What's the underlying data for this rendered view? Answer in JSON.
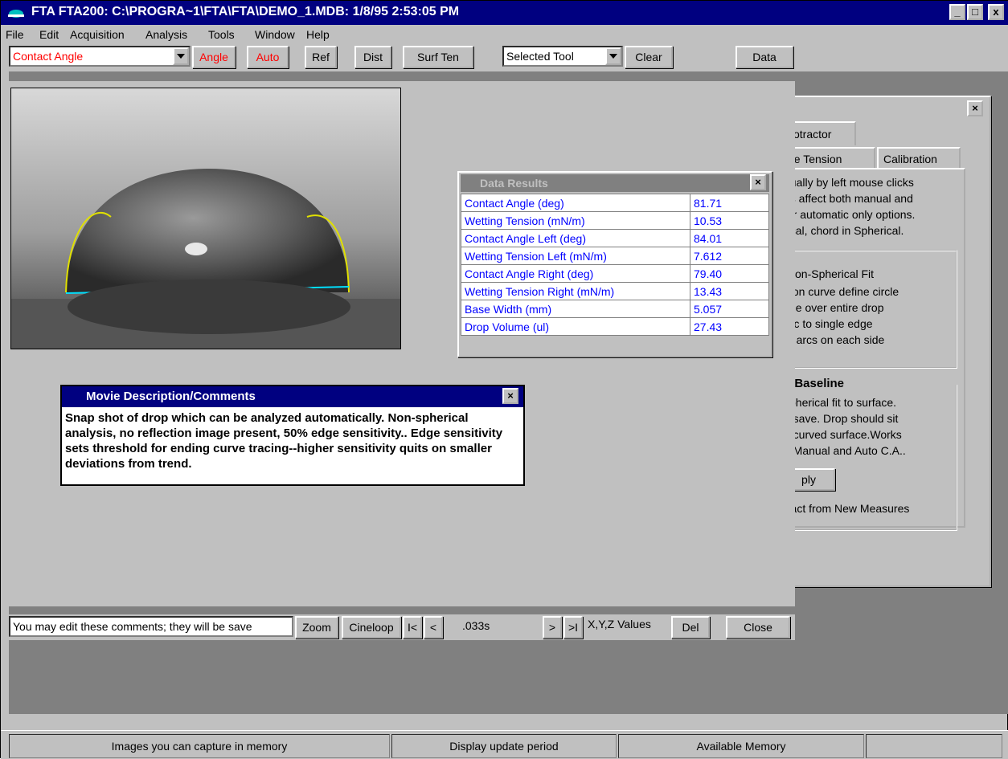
{
  "window": {
    "title": "FTA FTA200: C:\\PROGRA~1\\FTA\\FTA\\DEMO_1.MDB: 1/8/95 2:53:05 PM",
    "buttons": [
      "_",
      "□",
      "x"
    ]
  },
  "menu": [
    "File",
    "Edit",
    "Acquisition",
    "Analysis",
    "Tools",
    "Window",
    "Help"
  ],
  "toolbar": {
    "mode_value": "Contact Angle",
    "angle": "Angle",
    "auto": "Auto",
    "ref": "Ref",
    "dist": "Dist",
    "surften": "Surf Ten",
    "tool_value": "Selected Tool",
    "clear": "Clear",
    "data": "Data"
  },
  "results": {
    "title": "Data Results",
    "rows": [
      {
        "label": "Contact Angle (deg)",
        "value": "81.71"
      },
      {
        "label": "Wetting Tension (mN/m)",
        "value": "10.53"
      },
      {
        "label": "Contact Angle Left (deg)",
        "value": "84.01"
      },
      {
        "label": "Wetting Tension Left (mN/m)",
        "value": "7.612"
      },
      {
        "label": "Contact Angle Right (deg)",
        "value": "79.40"
      },
      {
        "label": "Wetting Tension Right (mN/m)",
        "value": "13.43"
      },
      {
        "label": "Base Width (mm)",
        "value": "5.057"
      },
      {
        "label": "Drop Volume (ul)",
        "value": "27.43"
      }
    ]
  },
  "movie": {
    "title": "Movie Description/Comments",
    "text": "Snap shot of drop which can be analyzed automatically. Non-spherical analysis, no reflection image present, 50% edge sensitivity..  Edge sensitivity sets threshold for ending curve tracing--higher sensitivity quits on smaller deviations from trend."
  },
  "bottom": {
    "comment_hint": "You may edit these comments; they will be save",
    "zoom": "Zoom",
    "cineloop": "Cineloop",
    "first": "I<",
    "prev": "<",
    "frame_time": ".033s",
    "next": ">",
    "last": ">I",
    "xyz": "X,Y,Z Values",
    "del": "Del",
    "close": "Close"
  },
  "panel": {
    "tab_protractor": "Protractor",
    "tab_surface": "ace Tension",
    "tab_calibration": "Calibration",
    "intro": [
      "nually by left mouse clicks",
      "ns affect both manual and",
      "for automatic only options.",
      "rical, chord in Spherical."
    ],
    "fit": [
      "/Non-Spherical Fit",
      "s on curve define circle",
      "rcle over entire drop",
      "arc to single edge",
      "te arcs on each side"
    ],
    "baseline_title": "d Baseline",
    "baseline": [
      "spherical fit to surface.",
      "o save.  Drop should sit",
      "n curved surface.Works",
      "n Manual and Auto C.A.."
    ],
    "apply": "ply",
    "subtract": "tract from New Measures"
  },
  "status": [
    "Images you can capture in memory",
    "Display update period",
    "Available Memory"
  ]
}
